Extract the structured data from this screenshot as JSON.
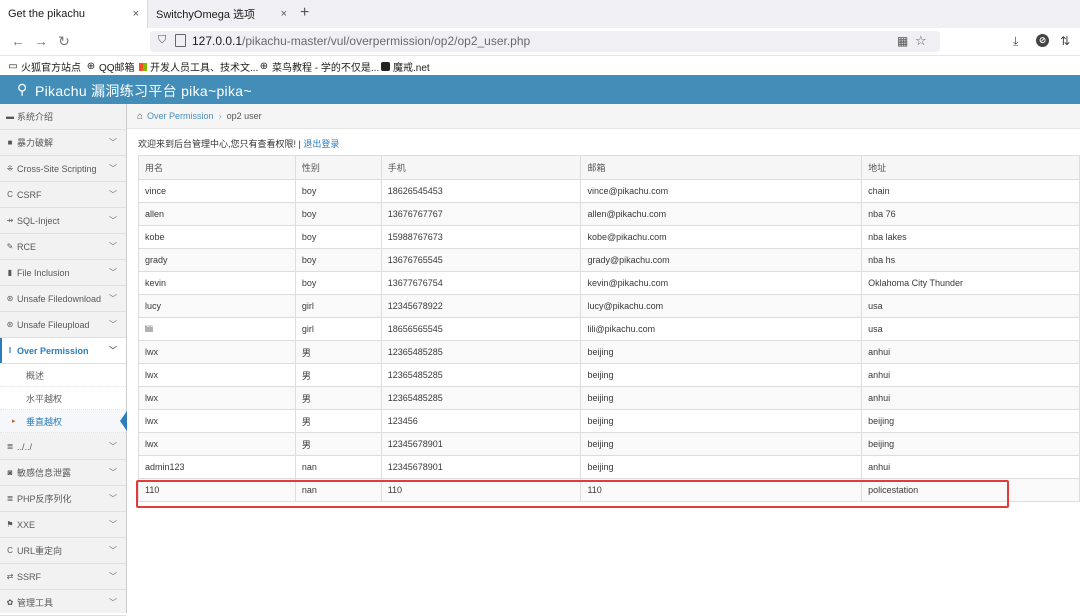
{
  "browser": {
    "tabs": [
      {
        "title": "Get the pikachu",
        "close": "×"
      },
      {
        "title": "SwitchyOmega 选项",
        "close": "×"
      }
    ],
    "new_tab": "+",
    "url_host": "127.0.0.1",
    "url_path": "/pikachu-master/vul/overpermission/op2/op2_user.php",
    "bookmarks": [
      "火狐官方站点",
      "QQ邮箱",
      "开发人员工具、技术文...",
      "菜鸟教程 - 学的不仅是...",
      "魔戒.net"
    ]
  },
  "site": {
    "title": "Pikachu 漏洞练习平台 pika~pika~"
  },
  "sidebar": {
    "items": [
      {
        "label": "系统介绍",
        "icon": "desktop-icon",
        "chev": ""
      },
      {
        "label": "暴力破解",
        "icon": "lock-icon",
        "chev": "﹀"
      },
      {
        "label": "Cross-Site Scripting",
        "icon": "xss-icon",
        "chev": "﹀"
      },
      {
        "label": "CSRF",
        "icon": "csrf-icon",
        "chev": "﹀"
      },
      {
        "label": "SQL-Inject",
        "icon": "sql-icon",
        "chev": "﹀"
      },
      {
        "label": "RCE",
        "icon": "pencil-icon",
        "chev": "﹀"
      },
      {
        "label": "File Inclusion",
        "icon": "file-icon",
        "chev": "﹀"
      },
      {
        "label": "Unsafe Filedownload",
        "icon": "download-icon",
        "chev": "﹀"
      },
      {
        "label": "Unsafe Fileupload",
        "icon": "upload-icon",
        "chev": "﹀"
      },
      {
        "label": "Over Permission",
        "icon": "cursor-icon",
        "chev": "﹀"
      }
    ],
    "subitems": [
      "概述",
      "水平越权",
      "垂直越权"
    ],
    "items_after": [
      {
        "label": "../../",
        "icon": "list-icon",
        "chev": "﹀"
      },
      {
        "label": "敏感信息泄露",
        "icon": "camera-icon",
        "chev": "﹀"
      },
      {
        "label": "PHP反序列化",
        "icon": "list-icon",
        "chev": "﹀"
      },
      {
        "label": "XXE",
        "icon": "flag-icon",
        "chev": "﹀"
      },
      {
        "label": "URL重定向",
        "icon": "redirect-icon",
        "chev": "﹀"
      },
      {
        "label": "SSRF",
        "icon": "exchange-icon",
        "chev": "﹀"
      },
      {
        "label": "管理工具",
        "icon": "gear-icon",
        "chev": "﹀"
      }
    ]
  },
  "breadcrumb": {
    "link": "Over Permission",
    "separator": "›",
    "current": "op2 user"
  },
  "main": {
    "welcome": "欢迎来到后台管理中心,您只有查看权限! | ",
    "logout": "退出登录",
    "columns": [
      "用名",
      "性别",
      "手机",
      "邮箱",
      "地址"
    ],
    "rows": [
      [
        "vince",
        "boy",
        "18626545453",
        "vince@pikachu.com",
        "chain"
      ],
      [
        "allen",
        "boy",
        "13676767767",
        "allen@pikachu.com",
        "nba 76"
      ],
      [
        "kobe",
        "boy",
        "15988767673",
        "kobe@pikachu.com",
        "nba lakes"
      ],
      [
        "grady",
        "boy",
        "13676765545",
        "grady@pikachu.com",
        "nba hs"
      ],
      [
        "kevin",
        "boy",
        "13677676754",
        "kevin@pikachu.com",
        "Oklahoma City Thunder"
      ],
      [
        "lucy",
        "girl",
        "12345678922",
        "lucy@pikachu.com",
        "usa"
      ],
      [
        "lili",
        "girl",
        "18656565545",
        "lili@pikachu.com",
        "usa"
      ],
      [
        "lwx",
        "男",
        "12365485285",
        "beijing",
        "anhui"
      ],
      [
        "lwx",
        "男",
        "12365485285",
        "beijing",
        "anhui"
      ],
      [
        "lwx",
        "男",
        "12365485285",
        "beijing",
        "anhui"
      ],
      [
        "lwx",
        "男",
        "123456",
        "beijing",
        "beijing"
      ],
      [
        "lwx",
        "男",
        "12345678901",
        "beijing",
        "beijing"
      ],
      [
        "admin123",
        "nan",
        "12345678901",
        "beijing",
        "anhui"
      ],
      [
        "110",
        "nan",
        "110",
        "110",
        "policestation"
      ]
    ]
  },
  "colors": {
    "header": "#438eb9",
    "link": "#2b7dbc",
    "highlight_box": "#e23b3b"
  }
}
